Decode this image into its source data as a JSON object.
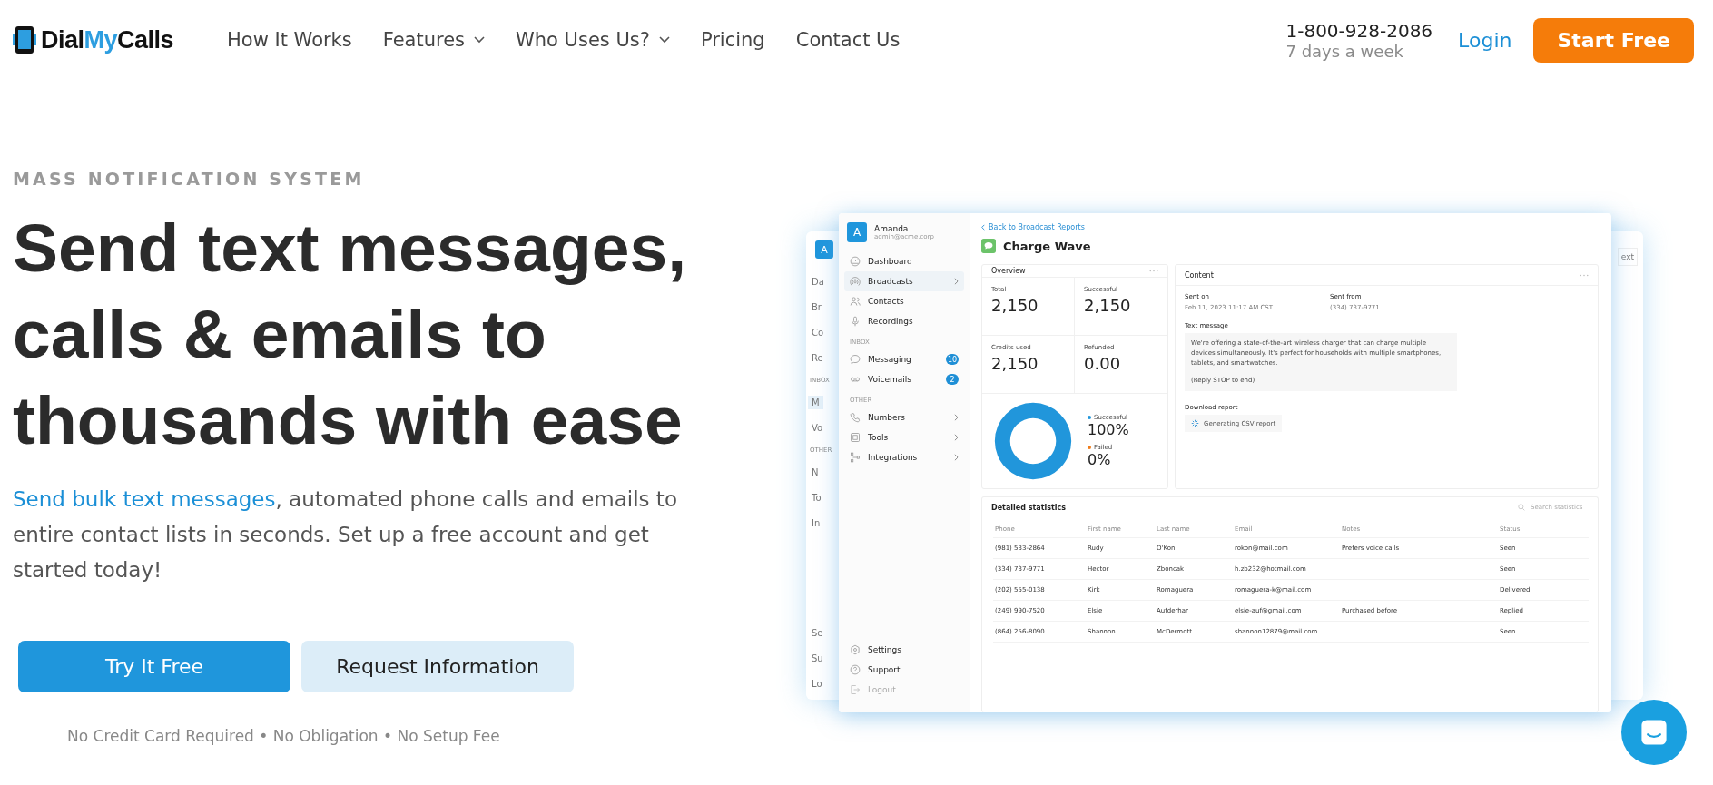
{
  "header": {
    "logo": [
      {
        "text": "Dial",
        "accent": false
      },
      {
        "text": "My",
        "accent": true
      },
      {
        "text": "Calls",
        "accent": false
      }
    ],
    "nav": [
      {
        "label": "How It Works",
        "dropdown": false
      },
      {
        "label": "Features",
        "dropdown": true
      },
      {
        "label": "Who Uses Us?",
        "dropdown": true
      },
      {
        "label": "Pricing",
        "dropdown": false
      },
      {
        "label": "Contact Us",
        "dropdown": false
      }
    ],
    "phone": "1-800-928-2086",
    "hours": "7 days a week",
    "login": "Login",
    "cta": "Start Free"
  },
  "hero": {
    "eyebrow": "MASS NOTIFICATION SYSTEM",
    "title_lines": [
      "Send text messages,",
      "calls & emails to",
      "thousands with ease"
    ],
    "intro_link": "Send bulk text messages",
    "intro": ", automated phone calls and emails to entire contact lists in seconds. Set up a free account and get started today!",
    "buttons": [
      {
        "label": "Try It Free",
        "primary": true
      },
      {
        "label": "Request Information",
        "primary": false
      }
    ],
    "footnote": "No Credit Card Required • No Obligation • No Setup Fee"
  },
  "mockup": {
    "back_panel": {
      "avatar": "A",
      "top_items": [
        "Da",
        "Br",
        "Co",
        "Re"
      ],
      "inbox_label": "INBOX",
      "inbox_items": [
        {
          "label": "M",
          "selected": true
        },
        {
          "label": "Vo",
          "selected": false
        }
      ],
      "other_label": "OTHER",
      "other_items": [
        "N",
        "To",
        "In"
      ],
      "bottom_items": [
        "Se",
        "Su",
        "Lo"
      ],
      "corner_button": "ext"
    },
    "sidebar": {
      "avatar": "A",
      "user": "Amanda",
      "email": "admin@acme.corp",
      "items": [
        {
          "label": "Dashboard",
          "selected": false,
          "chevron": false
        },
        {
          "label": "Broadcasts",
          "selected": true,
          "chevron": true
        },
        {
          "label": "Contacts",
          "selected": false,
          "chevron": false
        },
        {
          "label": "Recordings",
          "selected": false,
          "chevron": false
        }
      ],
      "inbox_label": "INBOX",
      "inbox_items": [
        {
          "label": "Messaging",
          "badge": "10"
        },
        {
          "label": "Voicemails",
          "badge": "2"
        }
      ],
      "other_label": "OTHER",
      "other_items": [
        {
          "label": "Numbers",
          "chevron": true
        },
        {
          "label": "Tools",
          "chevron": true
        },
        {
          "label": "Integrations",
          "chevron": true
        }
      ],
      "bottom_items": [
        {
          "label": "Settings",
          "dimmed": false
        },
        {
          "label": "Support",
          "dimmed": false
        },
        {
          "label": "Logout",
          "dimmed": true
        }
      ]
    },
    "back_link": "Back to Broadcast Reports",
    "title": "Charge Wave",
    "overview": {
      "title": "Overview",
      "stats": [
        {
          "label": "Total",
          "value": "2,150"
        },
        {
          "label": "Successful",
          "value": "2,150"
        },
        {
          "label": "Credits used",
          "value": "2,150"
        },
        {
          "label": "Refunded",
          "value": "0.00"
        }
      ],
      "chart_data": {
        "type": "donut",
        "categories": [
          "Successful",
          "Failed"
        ],
        "series": [
          {
            "color": "#2196db",
            "values": [
              100,
              0
            ]
          }
        ]
      },
      "legend": [
        {
          "value": "100%",
          "color": "#2196db"
        },
        {
          "value": "0%",
          "color": "#f07c1a"
        }
      ]
    },
    "content": {
      "title": "Content",
      "fields": [
        {
          "label": "Sent on",
          "value": "Feb 11, 2023 11:17 AM CST"
        },
        {
          "label": "Sent from",
          "value": "(334) 737-9771"
        }
      ],
      "message_label": "Text message",
      "message": "We're offering a state-of-the-art wireless charger that can charge multiple devices simultaneously. It's perfect for households with multiple smartphones, tablets, and smartwatches.",
      "message_footer": "(Reply STOP to end)",
      "download_label": "Download report",
      "download_status": "Generating CSV report"
    },
    "stats_table": {
      "title": "Detailed statistics",
      "search_placeholder": "Search statistics",
      "columns": [
        "Phone",
        "First name",
        "Last name",
        "Email",
        "Notes",
        "Status"
      ],
      "rows": [
        [
          "(981) 533-2864",
          "Rudy",
          "O'Kon",
          "rokon@mail.com",
          "Prefers voice calls",
          "Seen"
        ],
        [
          "(334) 737-9771",
          "Hector",
          "Zboncak",
          "h.zb232@hotmail.com",
          "",
          "Seen"
        ],
        [
          "(202) 555-0138",
          "Kirk",
          "Romaguera",
          "romaguera-k@mail.com",
          "",
          "Delivered"
        ],
        [
          "(249) 990-7520",
          "Elsie",
          "Aufderhar",
          "elsie-auf@gmail.com",
          "Purchased before",
          "Replied"
        ],
        [
          "(864) 256-8090",
          "Shannon",
          "McDermott",
          "shannon12879@mail.com",
          "",
          "Seen"
        ]
      ]
    }
  }
}
